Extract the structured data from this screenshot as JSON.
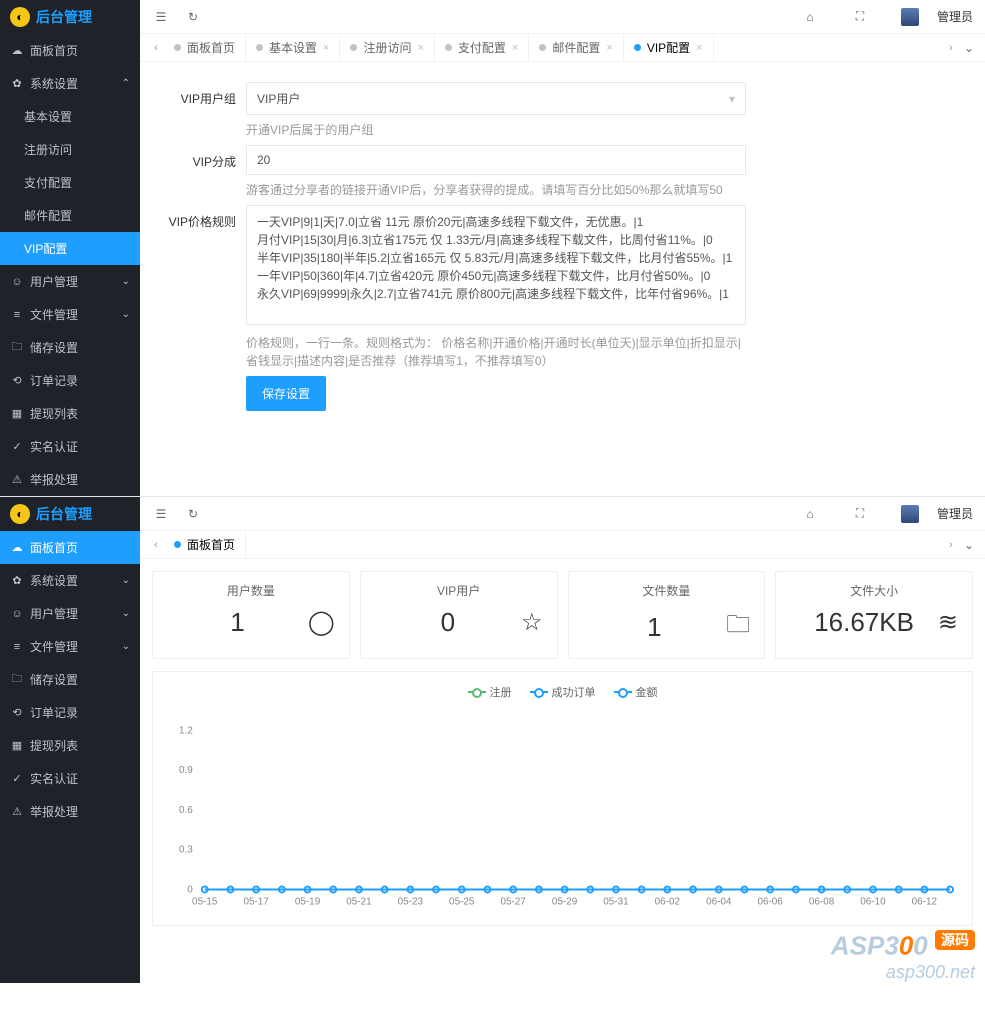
{
  "brand": "后台管理",
  "admin": "管理员",
  "menu": {
    "dashboard": "面板首页",
    "system": "系统设置",
    "basic": "基本设置",
    "register": "注册访问",
    "pay": "支付配置",
    "mail": "邮件配置",
    "vip": "VIP配置",
    "user": "用户管理",
    "file": "文件管理",
    "storage": "储存设置",
    "order": "订单记录",
    "withdraw": "提现列表",
    "realname": "实名认证",
    "report": "举报处理"
  },
  "tabs": {
    "home": "面板首页",
    "basic": "基本设置",
    "register": "注册访问",
    "pay": "支付配置",
    "mail": "邮件配置",
    "vip": "VIP配置"
  },
  "form": {
    "group_label": "VIP用户组",
    "group_value": "VIP用户",
    "group_hint": "开通VIP后属于的用户组",
    "share_label": "VIP分成",
    "share_value": "20",
    "share_hint": "游客通过分享者的链接开通VIP后，分享者获得的提成。请填写百分比如50%那么就填写50",
    "price_label": "VIP价格规则",
    "price_value": "一天VIP|9|1|天|7.0|立省 11元 原价20元|高速多线程下载文件，无优惠。|1\n月付VIP|15|30|月|6.3|立省175元 仅 1.33元/月|高速多线程下载文件，比周付省11%。|0\n半年VIP|35|180|半年|5.2|立省165元 仅 5.83元/月|高速多线程下载文件，比月付省55%。|1\n一年VIP|50|360|年|4.7|立省420元 原价450元|高速多线程下载文件，比月付省50%。|0\n永久VIP|69|9999|永久|2.7|立省741元 原价800元|高速多线程下载文件，比年付省96%。|1",
    "price_hint": "价格规则，一行一条。规则格式为： 价格名称|开通价格|开通时长(单位天)|显示单位|折扣显示|省钱显示|描述内容|是否推荐（推荐填写1，不推荐填写0）",
    "save": "保存设置"
  },
  "cards": [
    {
      "title": "用户数量",
      "value": "1",
      "icon": "user"
    },
    {
      "title": "VIP用户",
      "value": "0",
      "icon": "star"
    },
    {
      "title": "文件数量",
      "value": "1",
      "icon": "folder"
    },
    {
      "title": "文件大小",
      "value": "16.67KB",
      "icon": "layers"
    }
  ],
  "chart_data": {
    "type": "line",
    "series": [
      {
        "name": "注册",
        "color": "#5fb878",
        "values": [
          0,
          0,
          0,
          0,
          0,
          0,
          0,
          0,
          0,
          0,
          0,
          0,
          0,
          0,
          0,
          0,
          0,
          0,
          0,
          0,
          0,
          0,
          0,
          0,
          0,
          0,
          0,
          0,
          0,
          0
        ]
      },
      {
        "name": "成功订单",
        "color": "#1e9fff",
        "values": [
          0,
          0,
          0,
          0,
          0,
          0,
          0,
          0,
          0,
          0,
          0,
          0,
          0,
          0,
          0,
          0,
          0,
          0,
          0,
          0,
          0,
          0,
          0,
          0,
          0,
          0,
          0,
          0,
          0,
          0
        ]
      },
      {
        "name": "金额",
        "color": "#1e9fff",
        "values": [
          0,
          0,
          0,
          0,
          0,
          0,
          0,
          0,
          0,
          0,
          0,
          0,
          0,
          0,
          0,
          0,
          0,
          0,
          0,
          0,
          0,
          0,
          0,
          0,
          0,
          0,
          0,
          0,
          0,
          0
        ]
      }
    ],
    "x_labels": [
      "05-15",
      "05-17",
      "05-19",
      "05-21",
      "05-23",
      "05-25",
      "05-27",
      "05-29",
      "05-31",
      "06-02",
      "06-04",
      "06-06",
      "06-08",
      "06-10",
      "06-12"
    ],
    "y_ticks": [
      0,
      0.3,
      0.6,
      0.9,
      1.2
    ],
    "ylim": [
      0,
      1.2
    ]
  },
  "watermark": {
    "line1a": "ASP3",
    "line1b": "0",
    "line1c": "0",
    "badge": "源码",
    "line2": "asp300.net"
  }
}
